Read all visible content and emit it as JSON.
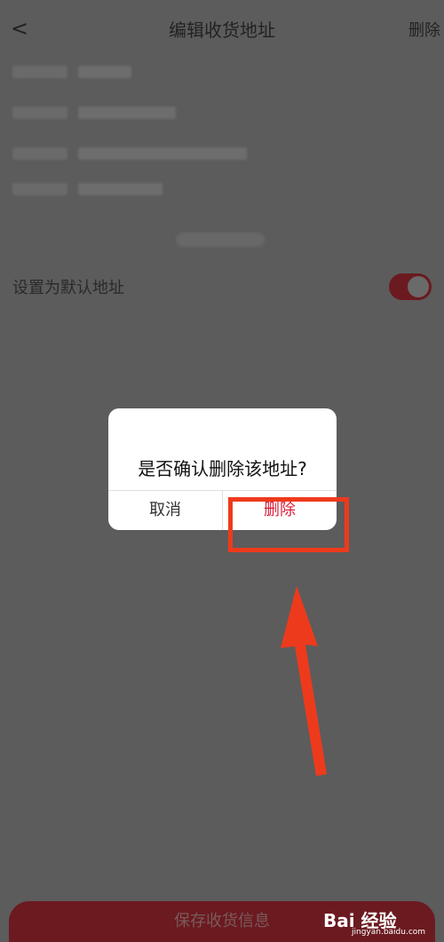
{
  "header": {
    "back_label": "<",
    "title": "编辑收货地址",
    "delete_label": "删除"
  },
  "default_setting": {
    "label": "设置为默认地址",
    "toggle_on": true,
    "toggle_color": "#6b1a20"
  },
  "dialog": {
    "message": "是否确认删除该地址?",
    "cancel_label": "取消",
    "delete_label": "删除",
    "delete_color": "#d81e3a"
  },
  "footer": {
    "save_label": "保存收货信息"
  },
  "watermark": {
    "text": "Bai 经验",
    "sub": "jingyan.baidu.com"
  },
  "annotation": {
    "color": "#ee3a1c"
  }
}
